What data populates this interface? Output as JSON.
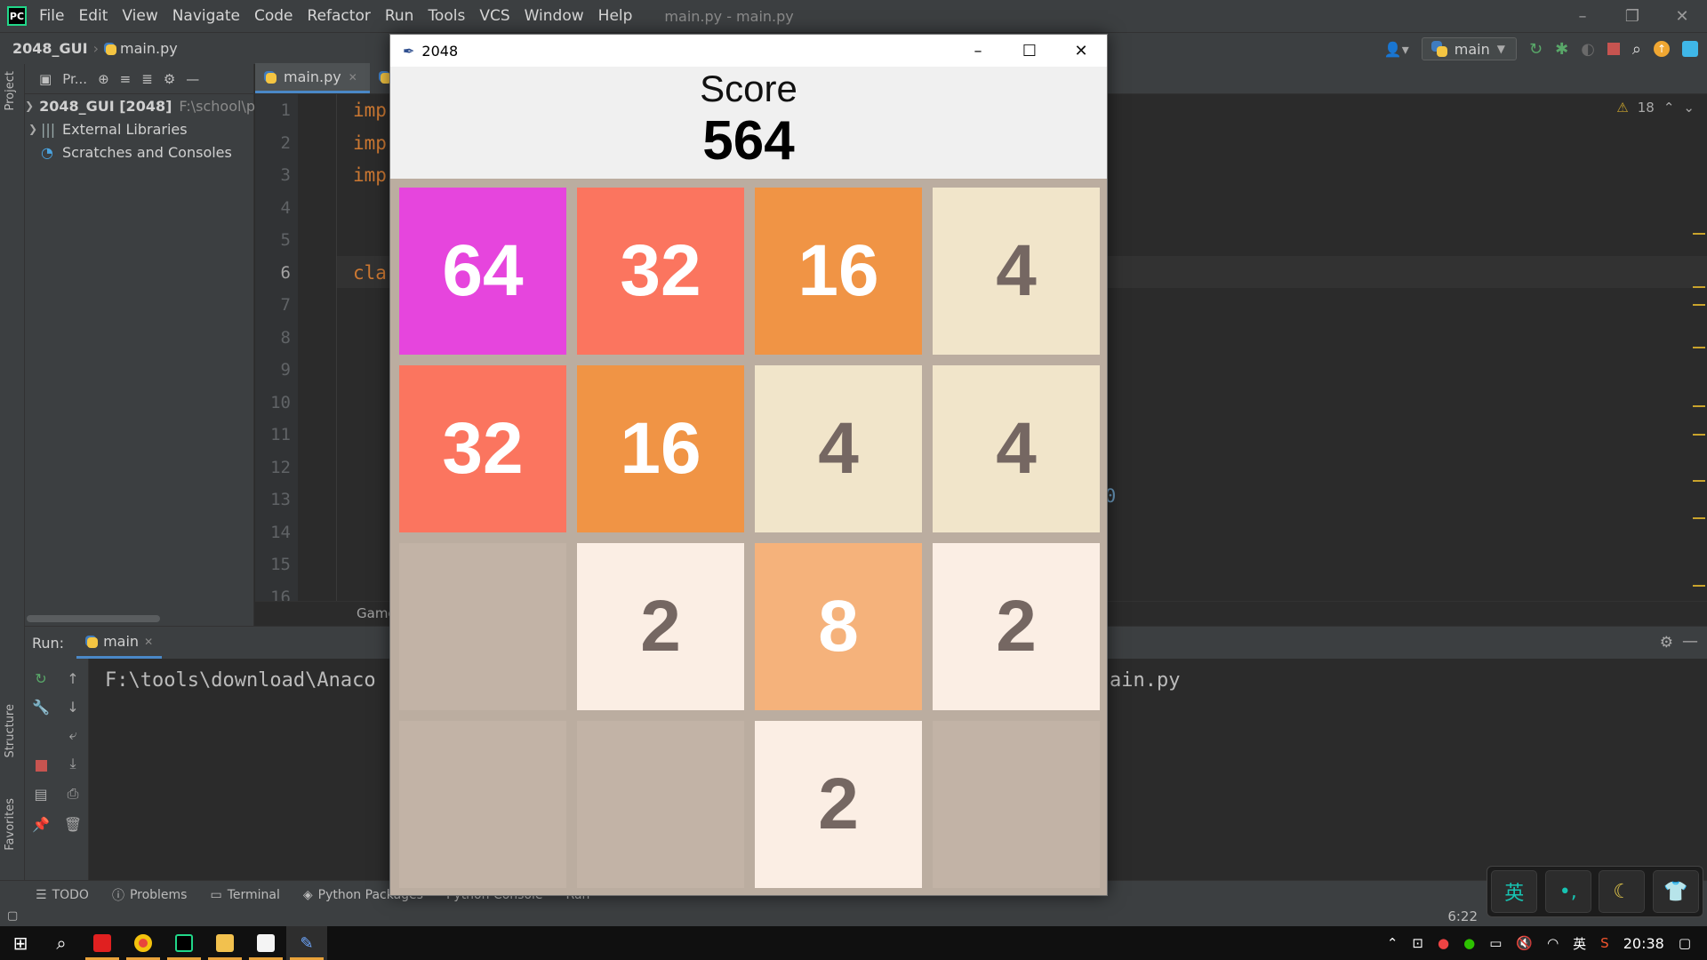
{
  "menubar": {
    "items": [
      "File",
      "Edit",
      "View",
      "Navigate",
      "Code",
      "Refactor",
      "Run",
      "Tools",
      "VCS",
      "Window",
      "Help"
    ],
    "window_title": "main.py - main.py"
  },
  "navbar": {
    "project": "2048_GUI",
    "file": "main.py",
    "run_config": "main"
  },
  "side_tabs": {
    "project": "Project",
    "structure": "Structure",
    "favorites": "Favorites"
  },
  "project_panel": {
    "toolbar_label": "Pr...",
    "tree": [
      {
        "label": "2048_GUI [2048]",
        "path": "F:\\school\\p"
      },
      {
        "label": "External Libraries"
      },
      {
        "label": "Scratches and Consoles"
      }
    ]
  },
  "editor": {
    "tab_label": "main.py",
    "line_numbers": [
      "1",
      "2",
      "3",
      "4",
      "5",
      "6",
      "7",
      "8",
      "9",
      "10",
      "11",
      "12",
      "13",
      "14",
      "15",
      "16"
    ],
    "code_lines": [
      "imp",
      "imp",
      "imp",
      "",
      "",
      "cla",
      "",
      "",
      "",
      "",
      "",
      "",
      "",
      "",
      "",
      ""
    ],
    "code_fragment_13": "00",
    "warning_count": "18",
    "breadcrumb_bottom": "Game"
  },
  "run_panel": {
    "label": "Run:",
    "tab": "main",
    "console_left": "F:\\tools\\download\\Anaco",
    "console_right": "ain.py"
  },
  "tool_windows": [
    "TODO",
    "Problems",
    "Terminal",
    "Python Packages",
    "Python Console",
    "Run"
  ],
  "status": {
    "cursor": "6:22"
  },
  "taskbar": {
    "clock": "20:38",
    "ime": "英"
  },
  "ime_widget": {
    "lang": "英"
  },
  "game": {
    "window_title": "2048",
    "score_label": "Score",
    "score": "564",
    "tiles": [
      [
        "64",
        "32",
        "16",
        "4"
      ],
      [
        "32",
        "16",
        "4",
        "4"
      ],
      [
        "",
        "2",
        "8",
        "2"
      ],
      [
        "",
        "",
        "2",
        ""
      ]
    ],
    "colors": {
      "empty": "#c2b3a6",
      "2": "#fbeee4",
      "4": "#f1e5ca",
      "8": "#f5b27b",
      "16": "#f09445",
      "32": "#fb755f",
      "64": "#e645dd",
      "dark_text": "#756762",
      "light_text": "#ffffff",
      "board": "#bbada0"
    }
  }
}
